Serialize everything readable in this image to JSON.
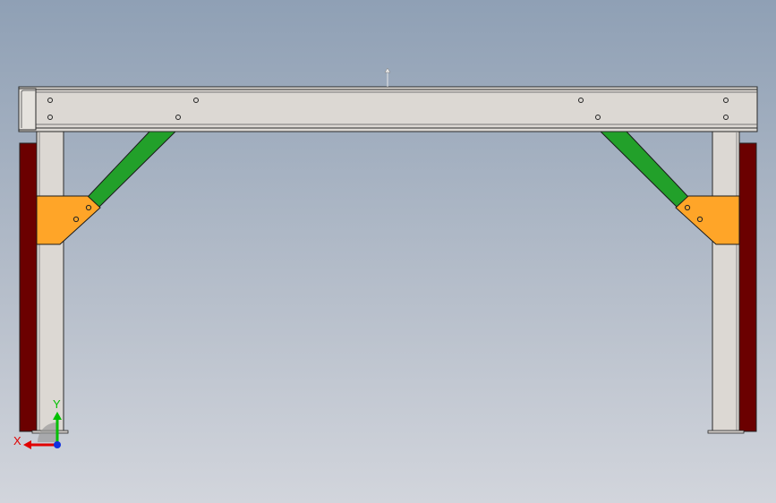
{
  "triad": {
    "x_label": "X",
    "y_label": "Y"
  },
  "colors": {
    "frame_gray": "#dcd8d3",
    "frame_edge": "#2a2a2a",
    "brace_green": "#22a02a",
    "gusset_orange": "#ffa528",
    "side_plate_red": "#6b0000",
    "axis_x_red": "#e00000",
    "axis_y_green": "#00c000",
    "origin_blue": "#1030e0"
  },
  "icons": {
    "up_arrow": "up-arrow-icon",
    "triad": "coordinate-triad-icon"
  }
}
